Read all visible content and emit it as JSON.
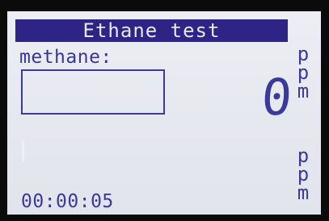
{
  "display": {
    "title": "Ethane test",
    "gas_label": "methane:",
    "reading_value": "0",
    "unit_top": [
      "p",
      "p",
      "m"
    ],
    "unit_bottom": [
      "p",
      "p",
      "m"
    ],
    "elapsed_time": "00:00:05"
  },
  "colors": {
    "title_background": "#2e2486",
    "text": "#3a3a9c",
    "screen_background": "#e6e8ef"
  }
}
